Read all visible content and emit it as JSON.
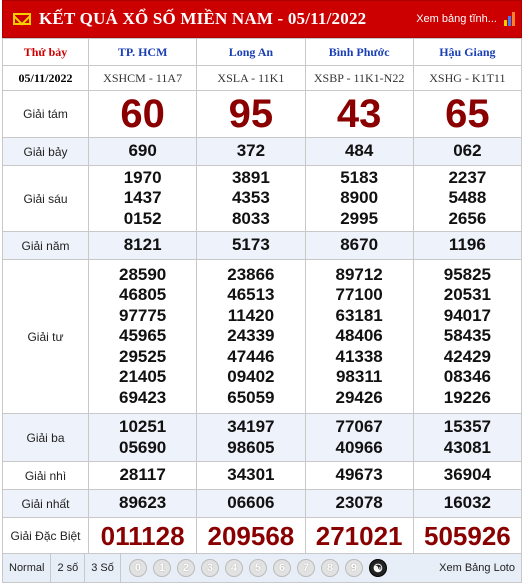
{
  "header": {
    "title": "KẾT QUẢ XỔ SỐ MIỀN NAM - 05/11/2022",
    "link": "Xem bảng tĩnh..."
  },
  "table": {
    "day": "Thứ bảy",
    "date": "05/11/2022",
    "provinces": [
      {
        "name": "TP. HCM",
        "code": "XSHCM - 11A7"
      },
      {
        "name": "Long An",
        "code": "XSLA - 11K1"
      },
      {
        "name": "Bình Phước",
        "code": "XSBP - 11K1-N22"
      },
      {
        "name": "Hậu Giang",
        "code": "XSHG - K1T11"
      }
    ],
    "prizes": [
      {
        "label": "Giải tám",
        "style": "big",
        "values": [
          [
            "60"
          ],
          [
            "95"
          ],
          [
            "43"
          ],
          [
            "65"
          ]
        ]
      },
      {
        "label": "Giải bảy",
        "style": "num",
        "values": [
          [
            "690"
          ],
          [
            "372"
          ],
          [
            "484"
          ],
          [
            "062"
          ]
        ]
      },
      {
        "label": "Giải sáu",
        "style": "num",
        "values": [
          [
            "1970",
            "1437",
            "0152"
          ],
          [
            "3891",
            "4353",
            "8033"
          ],
          [
            "5183",
            "8900",
            "2995"
          ],
          [
            "2237",
            "5488",
            "2656"
          ]
        ]
      },
      {
        "label": "Giải năm",
        "style": "num",
        "values": [
          [
            "8121"
          ],
          [
            "5173"
          ],
          [
            "8670"
          ],
          [
            "1196"
          ]
        ]
      },
      {
        "label": "Giải tư",
        "style": "num",
        "values": [
          [
            "28590",
            "46805",
            "97775",
            "45965",
            "29525",
            "21405",
            "69423"
          ],
          [
            "23866",
            "46513",
            "11420",
            "24339",
            "47446",
            "09402",
            "65059"
          ],
          [
            "89712",
            "77100",
            "63181",
            "48406",
            "41338",
            "98311",
            "29426"
          ],
          [
            "95825",
            "20531",
            "94017",
            "58435",
            "42429",
            "08346",
            "19226"
          ]
        ]
      },
      {
        "label": "Giải ba",
        "style": "num",
        "values": [
          [
            "10251",
            "05690"
          ],
          [
            "34197",
            "98605"
          ],
          [
            "77067",
            "40966"
          ],
          [
            "15357",
            "43081"
          ]
        ]
      },
      {
        "label": "Giải nhì",
        "style": "num",
        "values": [
          [
            "28117"
          ],
          [
            "34301"
          ],
          [
            "49673"
          ],
          [
            "36904"
          ]
        ]
      },
      {
        "label": "Giải nhất",
        "style": "num",
        "values": [
          [
            "89623"
          ],
          [
            "06606"
          ],
          [
            "23078"
          ],
          [
            "16032"
          ]
        ]
      },
      {
        "label": "Giải Đặc Biệt",
        "style": "special",
        "values": [
          [
            "011128"
          ],
          [
            "209568"
          ],
          [
            "271021"
          ],
          [
            "505926"
          ]
        ]
      }
    ]
  },
  "footer": {
    "modes": [
      "Normal",
      "2 số",
      "3 Số"
    ],
    "digits": [
      "0",
      "1",
      "2",
      "3",
      "4",
      "5",
      "6",
      "7",
      "8",
      "9"
    ],
    "loto_link": "Xem Bảng Loto"
  },
  "colors": {
    "header_red": "#cc0000",
    "prize_red": "#8a0000",
    "province_blue": "#1a3fb5",
    "alt_row": "#eef2fa"
  },
  "icons": {
    "header_left": "mail-icon",
    "header_right": "bar-chart-icon",
    "footer_last": "yin-yang-icon"
  }
}
